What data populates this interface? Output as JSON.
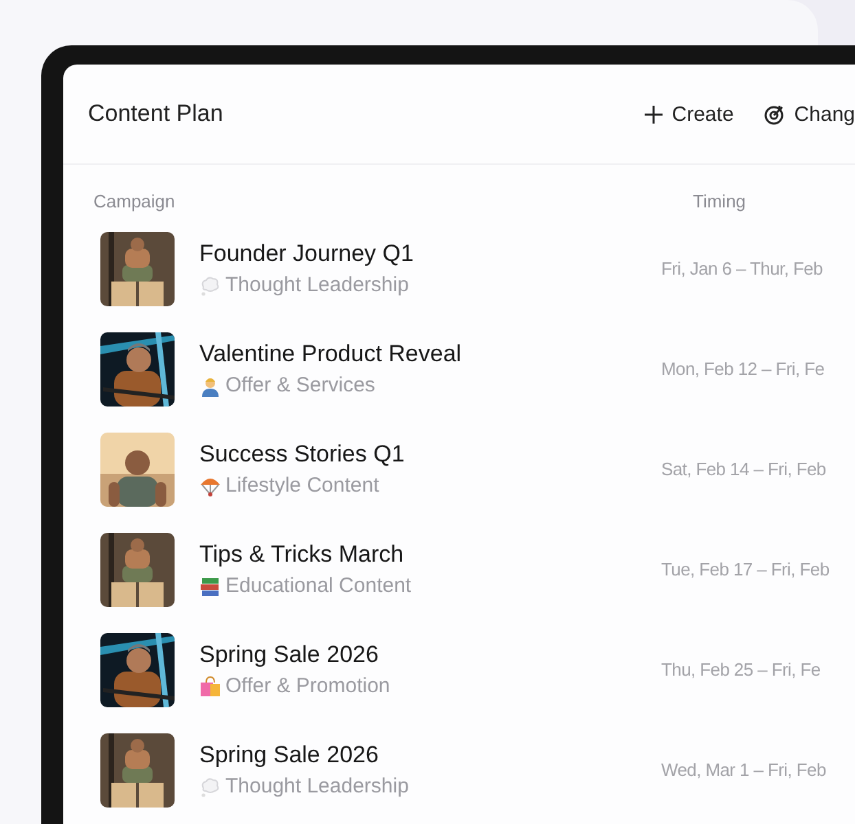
{
  "title": "Content Plan",
  "actions": [
    {
      "label": "Create",
      "kind": "plus"
    },
    {
      "label": "Chang",
      "kind": "target"
    }
  ],
  "columns": [
    "Campaign",
    "Timing"
  ],
  "rows": [
    {
      "name": "Founder Journey Q1",
      "category": {
        "label": "Thought Leadership",
        "kind": "thought"
      },
      "timing": "Fri, Jan 6 – Thur, Feb"
    },
    {
      "name": "Valentine Product Reveal",
      "category": {
        "label": "Offer & Services",
        "kind": "person"
      },
      "timing": "Mon, Feb 12 – Fri, Fe"
    },
    {
      "name": "Success Stories Q1",
      "category": {
        "label": "Lifestyle Content",
        "kind": "parachute"
      },
      "timing": "Sat, Feb 14 – Fri, Feb"
    },
    {
      "name": "Tips & Tricks March",
      "category": {
        "label": "Educational Content",
        "kind": "books"
      },
      "timing": "Tue, Feb 17 – Fri, Feb"
    },
    {
      "name": "Spring Sale 2026",
      "category": {
        "label": "Offer & Promotion",
        "kind": "bag"
      },
      "timing": "Thu, Feb 25 – Fri, Fe"
    },
    {
      "name": "Spring Sale 2026",
      "category": {
        "label": "Thought Leadership",
        "kind": "thought"
      },
      "timing": "Wed, Mar 1 – Fri, Feb"
    }
  ]
}
